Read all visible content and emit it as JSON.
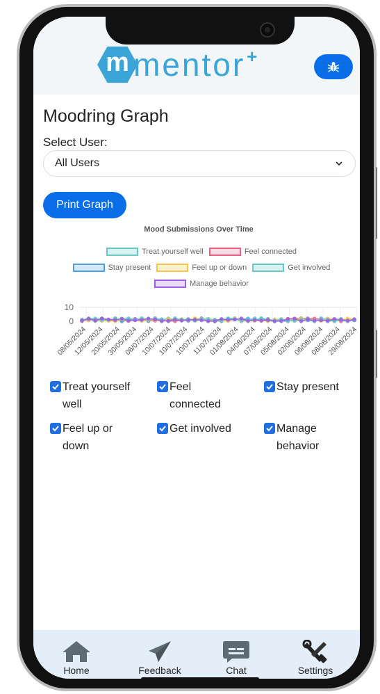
{
  "header": {
    "logo_text": "mentor",
    "logo_letter": "m",
    "logo_plus": "+",
    "bug_icon": "bug-icon"
  },
  "page": {
    "title": "Moodring Graph",
    "select_label": "Select User:",
    "select_value": "All Users",
    "print_label": "Print Graph"
  },
  "chart_data": {
    "type": "line",
    "title": "Mood Submissions Over Time",
    "legend": [
      {
        "name": "Treat yourself well",
        "color": "#66c9c2"
      },
      {
        "name": "Feel connected",
        "color": "#ef5f7f"
      },
      {
        "name": "Stay present",
        "color": "#4ea3e0"
      },
      {
        "name": "Feel up or down",
        "color": "#f5c84a"
      },
      {
        "name": "Get involved",
        "color": "#66c9c2"
      },
      {
        "name": "Manage behavior",
        "color": "#9b5fe0"
      }
    ],
    "y_ticks": [
      "10",
      "0"
    ],
    "ylim": [
      0,
      10
    ],
    "x_ticks": [
      "08/05/2024",
      "12/05/2024",
      "20/05/2024",
      "30/05/2024",
      "06/07/2024",
      "10/07/2024",
      "10/07/2024",
      "10/07/2024",
      "11/07/2024",
      "01/08/2024",
      "04/08/2024",
      "07/08/2024",
      "05/08/2024",
      "02/08/2024",
      "06/08/2024",
      "08/08/2024",
      "29/08/2024"
    ]
  },
  "checkboxes": [
    {
      "label": "Treat yourself well",
      "checked": true
    },
    {
      "label": "Feel connected",
      "checked": true
    },
    {
      "label": "Stay present",
      "checked": true
    },
    {
      "label": "Feel up or down",
      "checked": true
    },
    {
      "label": "Get involved",
      "checked": true
    },
    {
      "label": "Manage behavior",
      "checked": true
    }
  ],
  "nav": {
    "home": "Home",
    "feedback": "Feedback",
    "chat": "Chat",
    "settings": "Settings"
  }
}
